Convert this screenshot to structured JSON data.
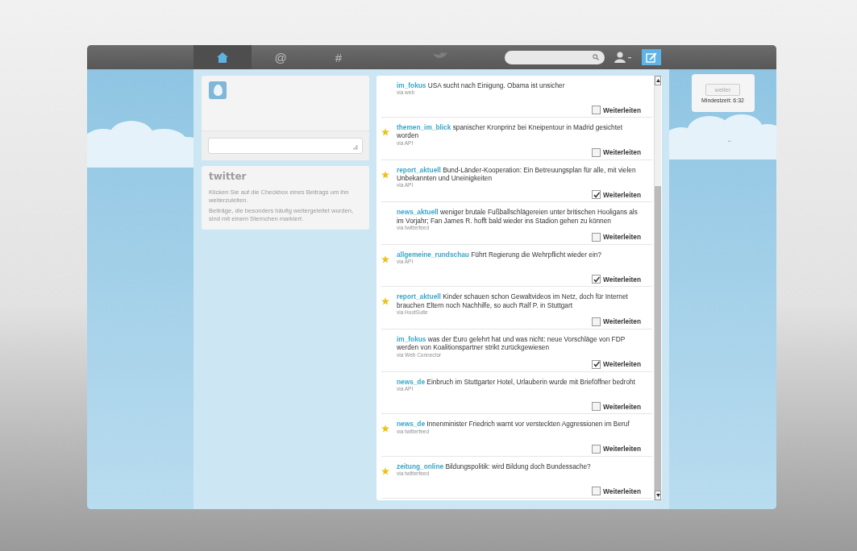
{
  "nav": {
    "tabs": [
      {
        "kind": "home",
        "selected": true
      },
      {
        "kind": "text",
        "label": "@",
        "selected": false
      },
      {
        "kind": "text",
        "label": "#",
        "selected": false
      }
    ]
  },
  "sidebar": {
    "logo": "twitter",
    "help": [
      "Klicken Sie auf die Checkbox eines Beitrags um ihn weiterzuleiten.",
      "Beiträge, die besonders häufig weitergeleitet wurden, sind mit einem Sternchen markiert."
    ]
  },
  "feed": {
    "tweets": [
      {
        "author": "im_fokus",
        "text": "USA sucht nach Einigung. Obama ist unsicher",
        "via": "via web",
        "starred": false,
        "forwarded": false,
        "action_label": "Weiterleiten"
      },
      {
        "author": "themen_im_blick",
        "text": "spanischer Kronprinz bei Kneipentour in Madrid gesichtet worden",
        "via": "via API",
        "starred": true,
        "forwarded": false,
        "action_label": "Weiterleiten"
      },
      {
        "author": "report_aktuell",
        "text": "Bund-Länder-Kooperation: Ein Betreuungsplan für alle, mit vielen Unbekannten und Uneinigkeiten",
        "via": "via API",
        "starred": true,
        "forwarded": true,
        "action_label": "Weiterleiten"
      },
      {
        "author": "news_aktuell",
        "text": "weniger brutale Fußballschlägereien unter britischen Hooligans als im Vorjahr; Fan James R. hofft bald wieder ins Stadion gehen zu können",
        "via": "via twitterfeed",
        "starred": false,
        "forwarded": false,
        "action_label": "Weiterleiten"
      },
      {
        "author": "allgemeine_rundschau",
        "text": "Führt Regierung die Wehrpflicht wieder ein?",
        "via": "via API",
        "starred": true,
        "forwarded": true,
        "action_label": "Weiterleiten"
      },
      {
        "author": "report_aktuell",
        "text": "Kinder schauen schon Gewaltvideos im Netz, doch für Internet brauchen Eltern noch Nachhilfe, so auch Ralf P. in Stuttgart",
        "via": "via HootSuite",
        "starred": true,
        "forwarded": false,
        "action_label": "Weiterleiten"
      },
      {
        "author": "im_fokus",
        "text": "was der Euro gelehrt hat und was nicht: neue Vorschläge von FDP werden von Koalitionspartner strikt zurückgewiesen",
        "via": "via Web Connector",
        "starred": false,
        "forwarded": true,
        "action_label": "Weiterleiten"
      },
      {
        "author": "news_de",
        "text": "Einbruch im Stuttgarter Hotel, Urlauberin wurde mit Brieföffner bedroht",
        "via": "via API",
        "starred": false,
        "forwarded": false,
        "action_label": "Weiterleiten"
      },
      {
        "author": "news_de",
        "text": "Innenminister Friedrich warnt vor versteckten Aggressionen im Beruf",
        "via": "via twitterfeed",
        "starred": true,
        "forwarded": false,
        "action_label": "Weiterleiten"
      },
      {
        "author": "zeitung_online",
        "text": "Bildungspolitik: wird Bildung doch Bundessache?",
        "via": "via twitterfeed",
        "starred": true,
        "forwarded": false,
        "action_label": "Weiterleiten"
      }
    ]
  },
  "timer": {
    "button": "weiter",
    "label": "Mindestzeit: 6:32"
  }
}
